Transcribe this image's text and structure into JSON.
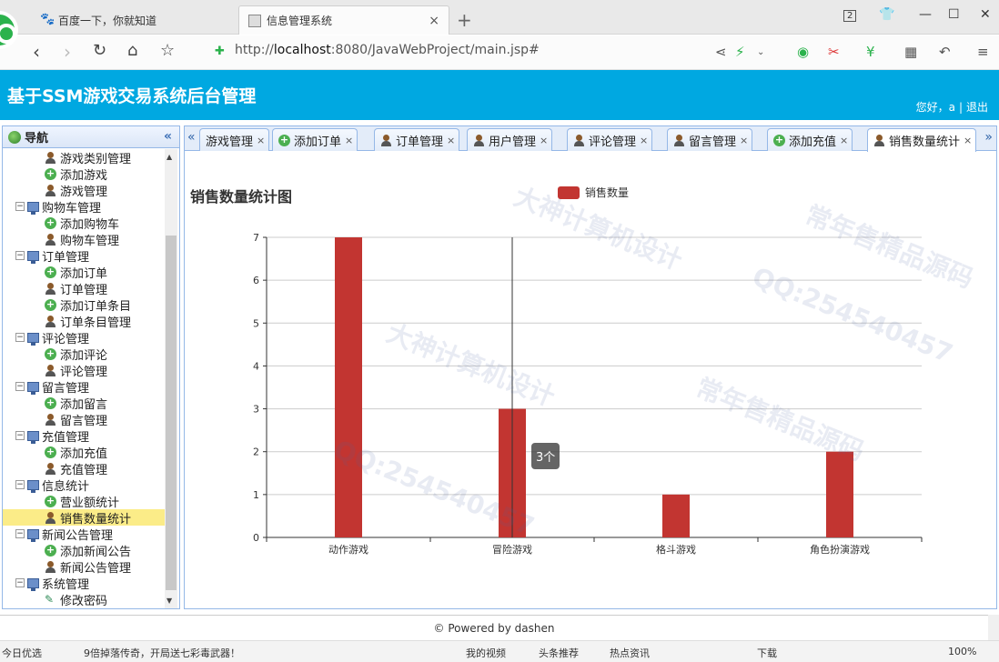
{
  "browser": {
    "tabs": [
      {
        "title": "百度一下，你就知道"
      },
      {
        "title": "信息管理系统",
        "close": "×"
      }
    ],
    "new_tab": "+",
    "window_badge": "2",
    "url_prefix": "http://",
    "url_host": "localhost",
    "url_rest": ":8080/JavaWebProject/main.jsp#"
  },
  "app": {
    "title": "基于SSM游戏交易系统后台管理",
    "greeting": "您好，a",
    "separator": "|",
    "logout": "退出"
  },
  "nav": {
    "header": "导航",
    "collapse": "«",
    "tree": [
      {
        "label": "游戏类别管理",
        "level": 2,
        "icon": "user-icon"
      },
      {
        "label": "添加游戏",
        "level": 2,
        "icon": "add-icon"
      },
      {
        "label": "游戏管理",
        "level": 2,
        "icon": "user-icon"
      },
      {
        "label": "购物车管理",
        "level": 1,
        "icon": "folder-icon"
      },
      {
        "label": "添加购物车",
        "level": 2,
        "icon": "add-icon"
      },
      {
        "label": "购物车管理",
        "level": 2,
        "icon": "user-icon"
      },
      {
        "label": "订单管理",
        "level": 1,
        "icon": "folder-icon"
      },
      {
        "label": "添加订单",
        "level": 2,
        "icon": "add-icon"
      },
      {
        "label": "订单管理",
        "level": 2,
        "icon": "user-icon"
      },
      {
        "label": "添加订单条目",
        "level": 2,
        "icon": "add-icon"
      },
      {
        "label": "订单条目管理",
        "level": 2,
        "icon": "user-icon"
      },
      {
        "label": "评论管理",
        "level": 1,
        "icon": "folder-icon"
      },
      {
        "label": "添加评论",
        "level": 2,
        "icon": "add-icon"
      },
      {
        "label": "评论管理",
        "level": 2,
        "icon": "user-icon"
      },
      {
        "label": "留言管理",
        "level": 1,
        "icon": "folder-icon"
      },
      {
        "label": "添加留言",
        "level": 2,
        "icon": "add-icon"
      },
      {
        "label": "留言管理",
        "level": 2,
        "icon": "user-icon"
      },
      {
        "label": "充值管理",
        "level": 1,
        "icon": "folder-icon"
      },
      {
        "label": "添加充值",
        "level": 2,
        "icon": "add-icon"
      },
      {
        "label": "充值管理",
        "level": 2,
        "icon": "user-icon"
      },
      {
        "label": "信息统计",
        "level": 1,
        "icon": "folder-icon"
      },
      {
        "label": "营业额统计",
        "level": 2,
        "icon": "add-icon"
      },
      {
        "label": "销售数量统计",
        "level": 2,
        "icon": "user-icon",
        "selected": true
      },
      {
        "label": "新闻公告管理",
        "level": 1,
        "icon": "folder-icon"
      },
      {
        "label": "添加新闻公告",
        "level": 2,
        "icon": "add-icon"
      },
      {
        "label": "新闻公告管理",
        "level": 2,
        "icon": "user-icon"
      },
      {
        "label": "系统管理",
        "level": 1,
        "icon": "folder-icon"
      },
      {
        "label": "修改密码",
        "level": 2,
        "icon": "pencil-icon"
      }
    ]
  },
  "tabs": {
    "items": [
      {
        "label": "游戏管理",
        "icon": "none"
      },
      {
        "label": "添加订单",
        "icon": "add-icon"
      },
      {
        "label": "订单管理",
        "icon": "user-icon"
      },
      {
        "label": "用户管理",
        "icon": "user-icon"
      },
      {
        "label": "评论管理",
        "icon": "user-icon"
      },
      {
        "label": "留言管理",
        "icon": "user-icon"
      },
      {
        "label": "添加充值",
        "icon": "add-icon"
      },
      {
        "label": "销售数量统计",
        "icon": "user-icon",
        "active": true
      }
    ],
    "close": "×",
    "scroll_left": "«",
    "scroll_right": "»"
  },
  "chart_data": {
    "type": "bar",
    "title": "销售数量统计图",
    "categories": [
      "动作游戏",
      "冒险游戏",
      "格斗游戏",
      "角色扮演游戏"
    ],
    "series": [
      {
        "name": "销售数量",
        "values": [
          7,
          3,
          1,
          2
        ]
      }
    ],
    "ylim": [
      0,
      7
    ],
    "yticks": [
      0,
      1,
      2,
      3,
      4,
      5,
      6,
      7
    ],
    "bar_color": "#c23531",
    "grid": true,
    "legend": "top-center",
    "tooltip": "3个"
  },
  "footer": {
    "text": "© Powered by dashen"
  },
  "statusbar": {
    "left": "今日优选",
    "news": "9倍掉落传奇，开局送七彩毒武器！",
    "video": "我的视频",
    "headline": "头条推荐",
    "hot": "热点资讯",
    "download": "下载",
    "zoom": "100%"
  },
  "watermarks": [
    "大神计算机设计",
    "QQ:254540457",
    "常年售精品源码"
  ]
}
